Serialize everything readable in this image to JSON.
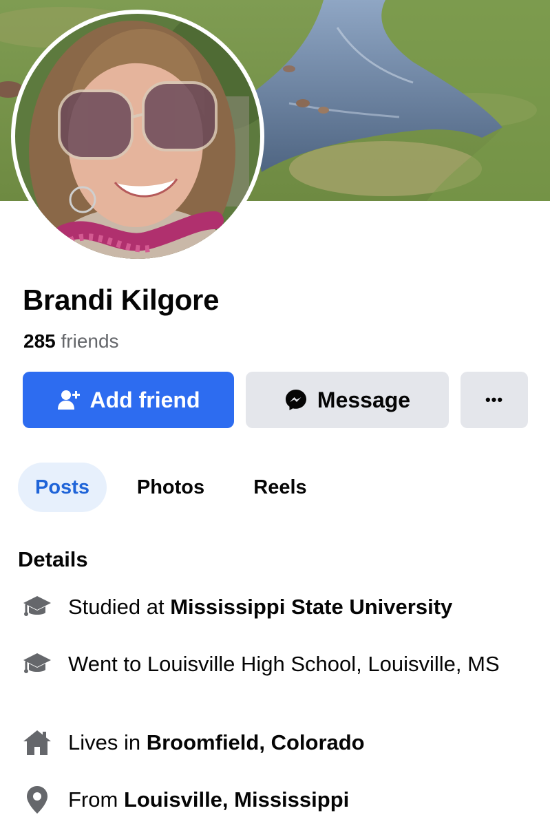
{
  "profile": {
    "name": "Brandi Kilgore",
    "friends_count": "285",
    "friends_label": "friends"
  },
  "actions": {
    "add_friend_label": "Add friend",
    "message_label": "Message",
    "more_label": "•••"
  },
  "tabs": [
    {
      "label": "Posts",
      "active": true
    },
    {
      "label": "Photos",
      "active": false
    },
    {
      "label": "Reels",
      "active": false
    }
  ],
  "details": {
    "heading": "Details",
    "items": [
      {
        "icon": "graduation-cap-icon",
        "prefix": "Studied at ",
        "value": "Mississippi State University"
      },
      {
        "icon": "graduation-cap-icon",
        "prefix": "Went to Louisville High School, Louisville, MS",
        "value": ""
      },
      {
        "icon": "home-icon",
        "prefix": "Lives in ",
        "value": "Broomfield, Colorado"
      },
      {
        "icon": "location-pin-icon",
        "prefix": "From ",
        "value": "Louisville, Mississippi"
      }
    ]
  },
  "colors": {
    "primary_button": "#2d6cf0",
    "secondary_button": "#e4e6eb",
    "active_tab_bg": "#e7f0fc",
    "active_tab_text": "#1f64d8",
    "secondary_text": "#65676b",
    "icon_gray": "#65676b"
  }
}
